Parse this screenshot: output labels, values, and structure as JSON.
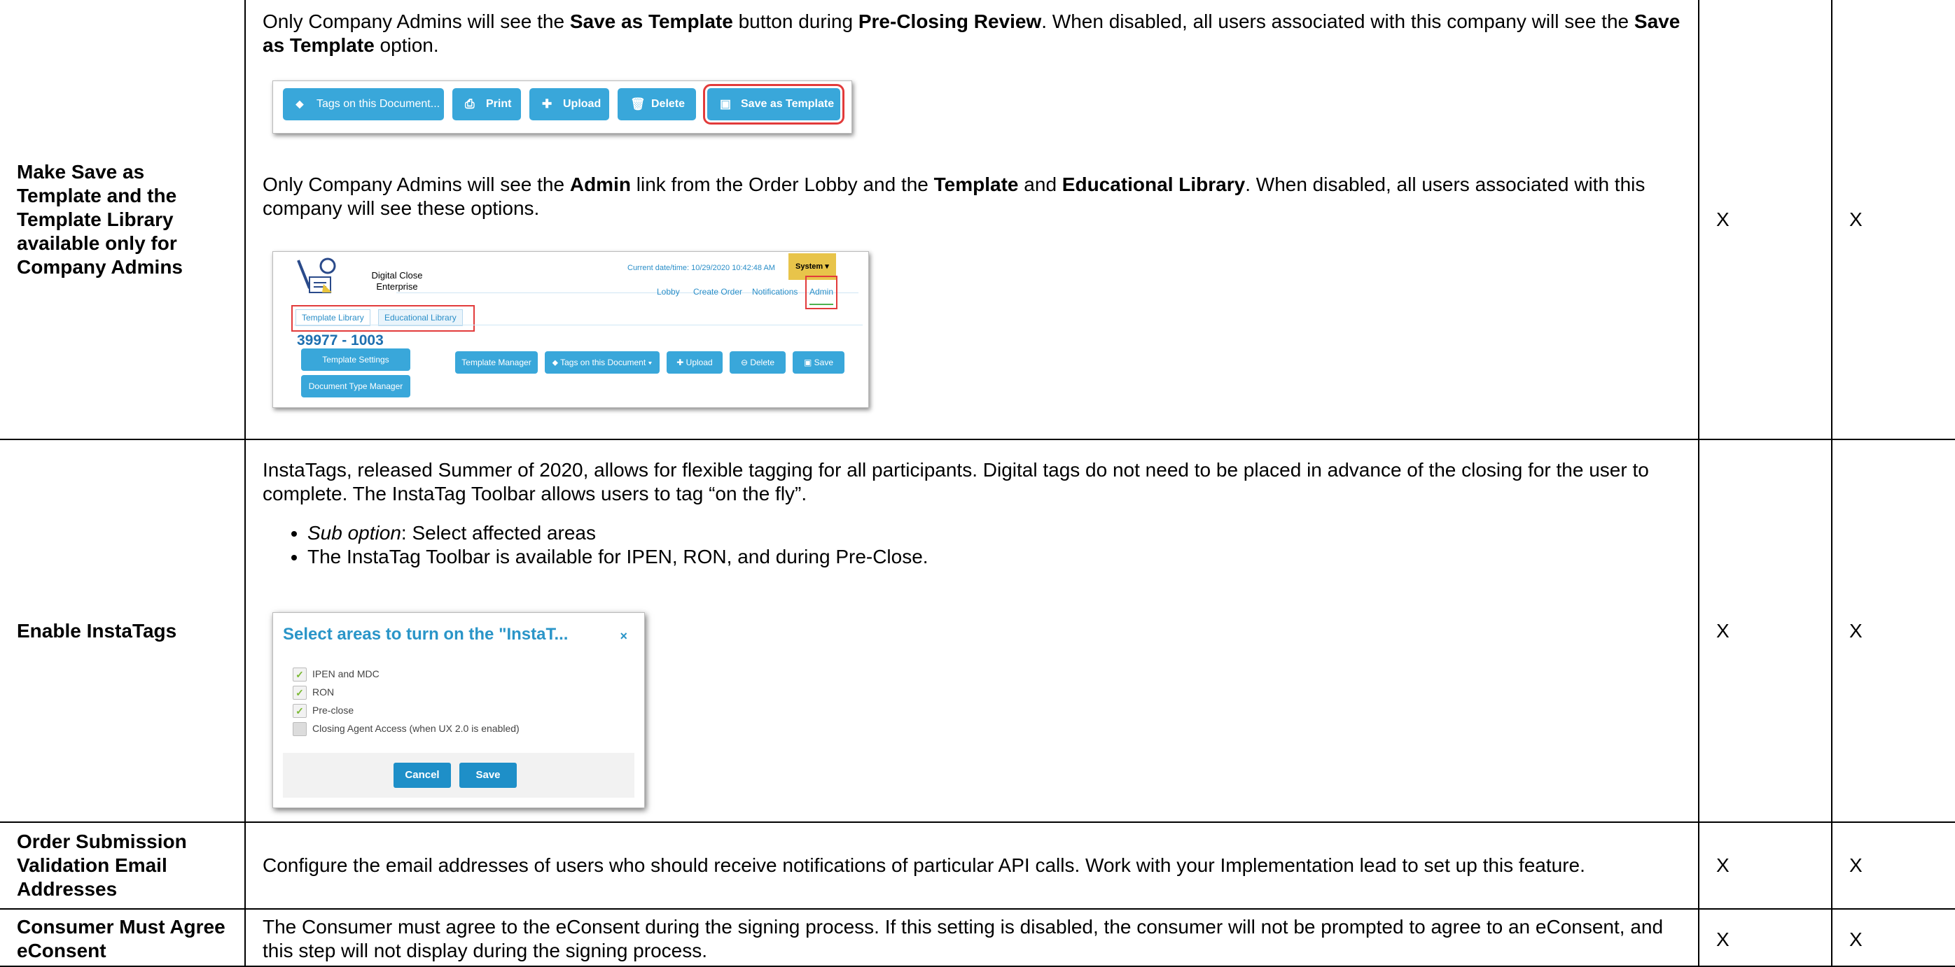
{
  "rows": [
    {
      "name": "Make Save as Template and the Template Library available only for Company Admins",
      "p1_a": "Only Company Admins will see the ",
      "p1_b1": "Save as Template",
      "p1_c": " button during ",
      "p1_b2": "Pre-Closing Review",
      "p1_d": ". When disabled, all users associated with this company will see the ",
      "p1_b3": "Save as Template",
      "p1_e": " option.",
      "toolbar": {
        "tags": "Tags on this Document...",
        "print": "Print",
        "upload": "Upload",
        "delete": "Delete",
        "save_template": "Save as Template",
        "icons": [
          "tag-icon",
          "print-icon",
          "plus-icon",
          "trash-icon",
          "save-icon"
        ]
      },
      "p2_a": "Only Company Admins will see the ",
      "p2_b1": "Admin",
      "p2_c": " link from the Order Lobby and the ",
      "p2_b2": "Template",
      "p2_d": " and ",
      "p2_b3": "Educational Library",
      "p2_e": ". When disabled, all users associated with this company will see these options.",
      "header_shot": {
        "datetime": "Current date/time: 10/29/2020 10:42:48 AM",
        "system": "System",
        "logo_line1": "Digital Close",
        "logo_line2": "Enterprise",
        "nav": [
          "Lobby",
          "Create Order",
          "Notifications",
          "Admin"
        ],
        "tabs": [
          "Template Library",
          "Educational Library"
        ],
        "order_id": "39977 - 1003",
        "template_settings": "Template Settings",
        "doc_type_manager": "Document Type Manager",
        "template_manager": "Template Manager",
        "tags": "Tags on this Document",
        "upload": "Upload",
        "delete": "Delete",
        "save": "Save"
      },
      "col3": "X",
      "col4": "X"
    },
    {
      "name": "Enable InstaTags",
      "p1": "InstaTags, released Summer of 2020, allows for flexible tagging for all participants. Digital tags do not need to be placed in advance of the closing for the user to complete. The InstaTag Toolbar allows users to tag “on the fly”.",
      "bullet1_em": "Sub option",
      "bullet1_rest": ": Select affected areas",
      "bullet2": "The InstaTag Toolbar is available for IPEN, RON, and during Pre-Close.",
      "dialog": {
        "title": "Select areas to turn on the \"InstaT...",
        "close": "×",
        "options": [
          {
            "label": "IPEN and MDC",
            "checked": true
          },
          {
            "label": "RON",
            "checked": true
          },
          {
            "label": "Pre-close",
            "checked": true
          },
          {
            "label": "Closing Agent Access (when UX 2.0 is enabled)",
            "checked": false
          }
        ],
        "cancel": "Cancel",
        "save": "Save"
      },
      "col3": "X",
      "col4": "X"
    },
    {
      "name": "Order Submission Validation Email Addresses",
      "desc": "Configure the email addresses of users who should receive notifications of particular API calls. Work with your Implementation lead to set up this feature.",
      "col3": "X",
      "col4": "X"
    },
    {
      "name": "Consumer Must Agree eConsent",
      "desc": "The Consumer must agree to the eConsent during the signing process. If this setting is disabled, the consumer will not be prompted to agree to an eConsent, and this step will not display during the signing process.",
      "col3": "X",
      "col4": "X"
    }
  ]
}
